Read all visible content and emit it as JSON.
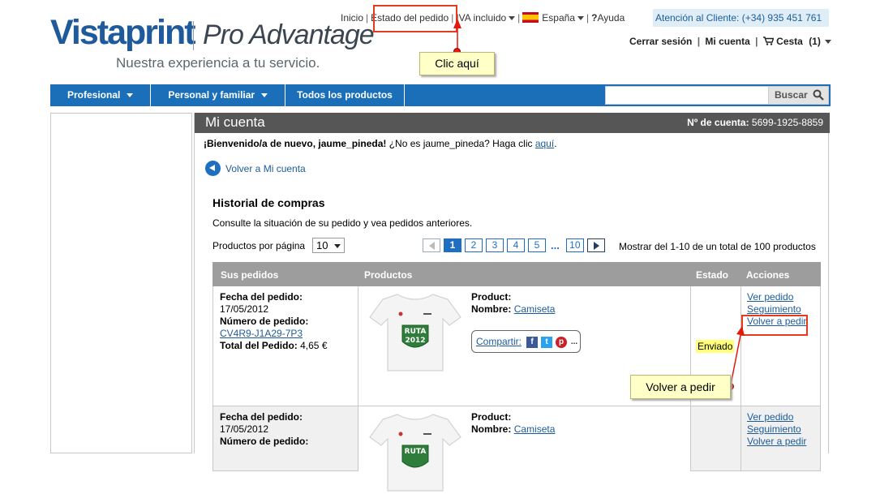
{
  "header": {
    "brand": "Vistaprint",
    "sub_brand": "Pro Advantage",
    "tagline": "Nuestra experiencia a tu servicio.",
    "top_links": {
      "home": "Inicio",
      "order_status": "Estado del pedido",
      "vat": "IVA incluido",
      "country": "España",
      "help": "Ayuda"
    },
    "support": "Atención al Cliente: (+34) 935 451 761",
    "user_links": {
      "logout": "Cerrar sesión",
      "my_account": "Mi cuenta",
      "cart": "Cesta",
      "cart_count": "(1)"
    }
  },
  "callouts": {
    "click_here": "Clic aquí",
    "reorder": "Volver a pedir"
  },
  "navbar": {
    "items": [
      "Profesional",
      "Personal y familiar",
      "Todos los productos"
    ],
    "search_button": "Buscar",
    "search_placeholder": ""
  },
  "account": {
    "title": "Mi cuenta",
    "account_label": "Nº de cuenta:",
    "account_number": "5699-1925-8859",
    "welcome_bold": "¡Bienvenido/a de nuevo, jaume_pineda!",
    "welcome_rest": " ¿No es jaume_pineda? Haga clic ",
    "welcome_link": "aquí",
    "welcome_end": ".",
    "back_link": "Volver a Mi cuenta"
  },
  "history": {
    "title": "Historial de compras",
    "description": "Consulte la situación de su pedido y vea pedidos anteriores.",
    "per_page_label": "Productos por página",
    "per_page_value": "10",
    "pages": [
      "1",
      "2",
      "3",
      "4",
      "5"
    ],
    "ellipsis": "...",
    "last_page": "10",
    "current_page": "1",
    "showing": "Mostrar del 1-10 de un total de 100 productos"
  },
  "table": {
    "headers": [
      "Sus pedidos",
      "Productos",
      "Estado",
      "Acciones"
    ],
    "rows": [
      {
        "date_label": "Fecha del pedido:",
        "date": "17/05/2012",
        "order_label": "Número de pedido:",
        "order_number": "CV4R9-J1A29-7P3",
        "total_label": "Total del Pedido:",
        "total": "4,65 €",
        "product_label": "Product:",
        "name_label": "Nombre:",
        "name": "Camiseta",
        "share_label": "Compartir:",
        "share_more": "...",
        "status": "Enviado",
        "actions": [
          "Ver pedido",
          "Seguimiento",
          "Volver a pedir"
        ]
      },
      {
        "date_label": "Fecha del pedido:",
        "date": "17/05/2012",
        "order_label": "Número de pedido:",
        "product_label": "Product:",
        "name_label": "Nombre:",
        "name": "Camiseta",
        "actions": [
          "Ver pedido",
          "Seguimiento",
          "Volver a pedir"
        ]
      }
    ]
  },
  "shirt_print": {
    "word": "RUTA",
    "year": "2012"
  },
  "colors": {
    "brand_blue": "#1e5a9c",
    "nav_blue": "#1a6fb8",
    "link_blue": "#1c5c9a",
    "header_gray": "#565656",
    "table_header": "#9d9d9d",
    "status_highlight": "#ffff7a",
    "callout_bg": "#ffffc8",
    "annotation_red": "#e53a1d"
  }
}
